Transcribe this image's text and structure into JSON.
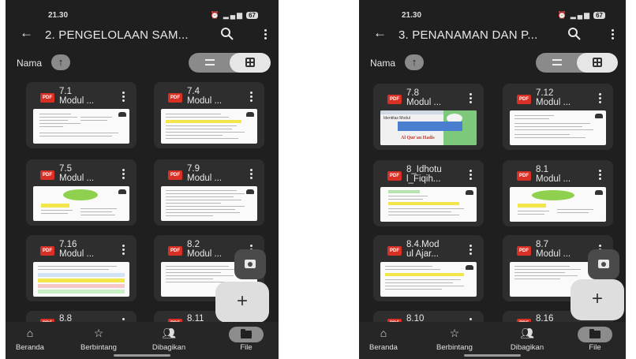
{
  "screens": [
    {
      "status": {
        "time": "21.30",
        "battery": "67"
      },
      "title": "2. PENGELOLAAN SAM...",
      "sort_label": "Nama",
      "files": [
        {
          "name": "7.1\nModul ..."
        },
        {
          "name": "7.4\nModul ..."
        },
        {
          "name": "7.5\nModul ..."
        },
        {
          "name": "7.9\nModul ..."
        },
        {
          "name": "7.16\nModul ..."
        },
        {
          "name": "8.2\nModul ..."
        },
        {
          "name": "8.8"
        },
        {
          "name": "8.11"
        }
      ],
      "nav": [
        "Beranda",
        "Berbintang",
        "Dibagikan",
        "File"
      ]
    },
    {
      "status": {
        "time": "21.30",
        "battery": "67"
      },
      "title": "3. PENANAMAN DAN P...",
      "sort_label": "Nama",
      "files": [
        {
          "name": "7.8\nModul ...",
          "thumb_text_1": "Identitas Modul",
          "thumb_text_2": "Al Qur'an Hadis"
        },
        {
          "name": "7.12\nModul ..."
        },
        {
          "name": "8_Idhotu\nl_Fiqih..."
        },
        {
          "name": "8.1\nModul ..."
        },
        {
          "name": "8.4.Mod\nul Ajar..."
        },
        {
          "name": "8.7\nModul ..."
        },
        {
          "name": "8.10"
        },
        {
          "name": "8.16"
        }
      ],
      "nav": [
        "Beranda",
        "Berbintang",
        "Dibagikan",
        "File"
      ]
    }
  ],
  "icons": {
    "back": "arrow-left-icon",
    "search": "search-icon",
    "more": "more-vert-icon",
    "sort": "arrow-up-icon",
    "list_view": "list-view-icon",
    "grid_view": "grid-view-icon",
    "pdf": "pdf-icon",
    "camera": "camera-icon",
    "add": "plus-icon",
    "home": "home-icon",
    "star": "star-icon",
    "shared": "people-icon",
    "folder": "folder-icon"
  },
  "pdf_badge_text": "PDF",
  "colors": {
    "background": "#1f1f1f",
    "card": "#2e2e2e",
    "pdf": "#d93025",
    "highlight_yellow": "#f2e64a",
    "green_oval": "#8fd14f"
  }
}
